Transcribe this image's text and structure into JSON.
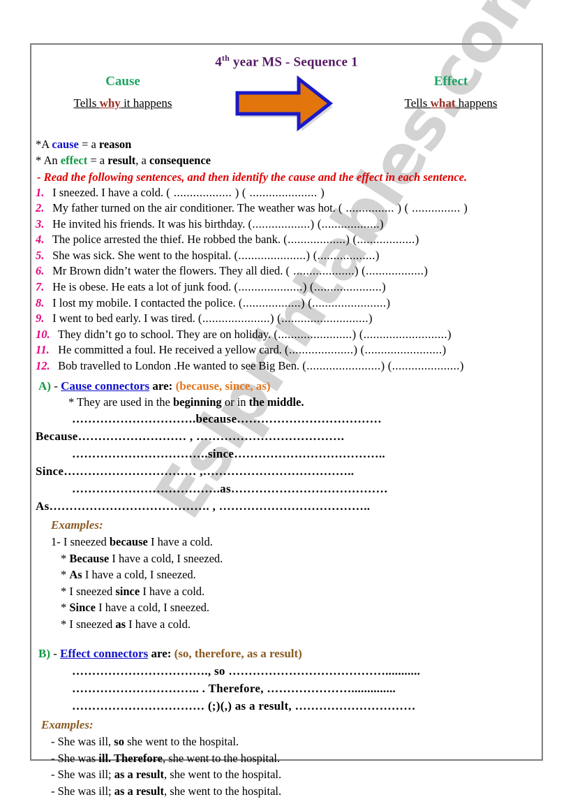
{
  "document": {
    "title_prefix": "4",
    "title_sup": "th",
    "title_rest": " year MS  - Sequence 1",
    "watermark": "Eslprintables.com"
  },
  "header": {
    "arrow_icon": "right-arrow-icon",
    "left": {
      "word": "Cause",
      "sub_pre": "Tells ",
      "sub_hi": "why",
      "sub_post": " it happens"
    },
    "right": {
      "word": "Effect",
      "sub_pre": "Tells ",
      "sub_hi": "what",
      "sub_post": " happens"
    }
  },
  "definitions": [
    {
      "prefix": "*A ",
      "term": "cause",
      "term_color": "blue",
      "rest": " = a ",
      "bold_tail": "reason",
      "tail2": ""
    },
    {
      "prefix": " * An ",
      "term": "effect",
      "term_color": "green",
      "rest": " = a ",
      "bold_tail": "result",
      "tail2": ", a ",
      "bold_tail2": "consequence"
    }
  ],
  "instruction": " - Read the following sentences, and then identify the cause and the effect in each sentence.",
  "sentences": [
    {
      "num": "1.",
      "text": "I sneezed. I have a cold.",
      "gap1_pad": "             ",
      "gap1": "( .................. )",
      "gap2_pad": "        ",
      "gap2": "( ..................... )"
    },
    {
      "num": "2.",
      "text": "My father turned on the air conditioner. The weather was hot.",
      "gap1_pad": " ",
      "gap1": "( ............... )",
      "gap2_pad": " ",
      "gap2": "( ............... )"
    },
    {
      "num": "3.",
      "text": "He invited his friends. It was his birthday.",
      "gap1_pad": " ",
      "gap1": "(..................)",
      "gap2_pad": "  ",
      "gap2": "(..................)"
    },
    {
      "num": "4.",
      "text": "The police arrested the thief. He robbed the bank.",
      "gap1_pad": " ",
      "gap1": "(..................)",
      "gap2_pad": "        ",
      "gap2": "(..................)"
    },
    {
      "num": "5.",
      "text": "She was sick. She went to the hospital.",
      "gap1_pad": " ",
      "gap1": "(.....................)",
      "gap2_pad": "          ",
      "gap2": "(..................)"
    },
    {
      "num": "6.",
      "text": "Mr Brown didn’t water the flowers. They all died.",
      "gap1_pad": " ",
      "gap1": "( ...................)",
      "gap2_pad": "  ",
      "gap2": "(..................)"
    },
    {
      "num": "7.",
      "text": "He is obese. He eats a lot of junk food.",
      "gap1_pad": "          ",
      "gap1": "(....................)",
      "gap2_pad": "      ",
      "gap2": "(.....................)"
    },
    {
      "num": "8.",
      "text": "I lost my mobile. I contacted the police.",
      "gap1_pad": "          ",
      "gap1": "(..................)",
      "gap2_pad": " ",
      "gap2": "(.......................)"
    },
    {
      "num": "9.",
      "text": "I went to bed early. I was tired.",
      "gap1_pad": "              ",
      "gap1": "(.....................)",
      "gap2_pad": " ",
      "gap2": "(...........................)"
    },
    {
      "num": "10.",
      "text": "They didn’t go to school. They are on holiday.",
      "gap1_pad": " ",
      "gap1": "(.......................)",
      "gap2_pad": " ",
      "gap2": "(..........................)"
    },
    {
      "num": "11.",
      "text": "He committed a foul. He received a yellow card.",
      "gap1_pad": " ",
      "gap1": "(....................)",
      "gap2_pad": " ",
      "gap2": "(........................)"
    },
    {
      "num": "12.",
      "text": "Bob travelled to London .He wanted to see Big Ben.",
      "gap1_pad": " ",
      "gap1": "(.......................)",
      "gap2_pad": " ",
      "gap2": "(.....................)"
    }
  ],
  "section_a": {
    "letter": "A)",
    "dash": " - ",
    "name": "Cause connectors",
    "are": " are:",
    "connectors": "  (because, since, as)",
    "usage_pre": "* They are used in the ",
    "usage_b1": "beginning",
    "usage_mid": " or in ",
    "usage_b2": "the middle.",
    "blanks": [
      "………………………….because………………………………",
      "Because……………………… , ……………………………….",
      "…………………………….since………………………………..",
      "Since…………………………… ,………………………………..",
      "……………………………….as…………………………………",
      "As…………………………………. , ……………………………….."
    ],
    "examples_label": "Examples:",
    "examples": [
      {
        "pre": "1- I sneezed ",
        "bold": "because",
        "post": " I have a cold.",
        "indent": false
      },
      {
        "pre": "* ",
        "bold": "Because",
        "post": " I have a cold, I sneezed.",
        "indent": true
      },
      {
        "pre": "* ",
        "bold": "As",
        "post": " I have a cold, I sneezed.",
        "indent": true
      },
      {
        "pre": "* I sneezed ",
        "bold": "since",
        "post": " I have a cold.",
        "indent": true
      },
      {
        "pre": "* ",
        "bold": "Since",
        "post": " I have a cold, I sneezed.",
        "indent": true
      },
      {
        "pre": "* I sneezed ",
        "bold": "as",
        "post": " I have a cold.",
        "indent": true
      }
    ]
  },
  "section_b": {
    "letter": "B)",
    "dash": " - ",
    "name": "Effect connectors",
    "are": " are:",
    "connectors": "  (so, therefore, as a result)",
    "blanks": [
      "……………………………., so  …………………………………...........",
      "………………………….. . Therefore, …………………..............",
      "…………………………… (;)(,) as a result, …………………………"
    ],
    "examples_label": "Examples:",
    "examples": [
      {
        "pre": "- She was ill, ",
        "bold": "so",
        "post": " she went to the hospital."
      },
      {
        "pre": "- She was ",
        "bold": "ill. Therefore",
        "post": ", she went to the hospital."
      },
      {
        "pre": "- She was ill; ",
        "bold": "as a result",
        "post": ", she went to the hospital."
      },
      {
        "pre": "- She was ill; ",
        "bold": "as a result",
        "post": ", she went to the hospital."
      }
    ]
  },
  "colors": {
    "title": "#551a63",
    "heading_green": "#1fa463",
    "cause_blue": "#1111cc",
    "effect_green": "#119944",
    "instruction_red": "#e00000",
    "number_magenta": "#e6007e",
    "connector_orange": "#e4761b",
    "connector_brown": "#8a5a20",
    "arrow_fill": "#e2760c",
    "arrow_stroke": "#1a19c8",
    "frame_border": "#7d7d7d"
  }
}
